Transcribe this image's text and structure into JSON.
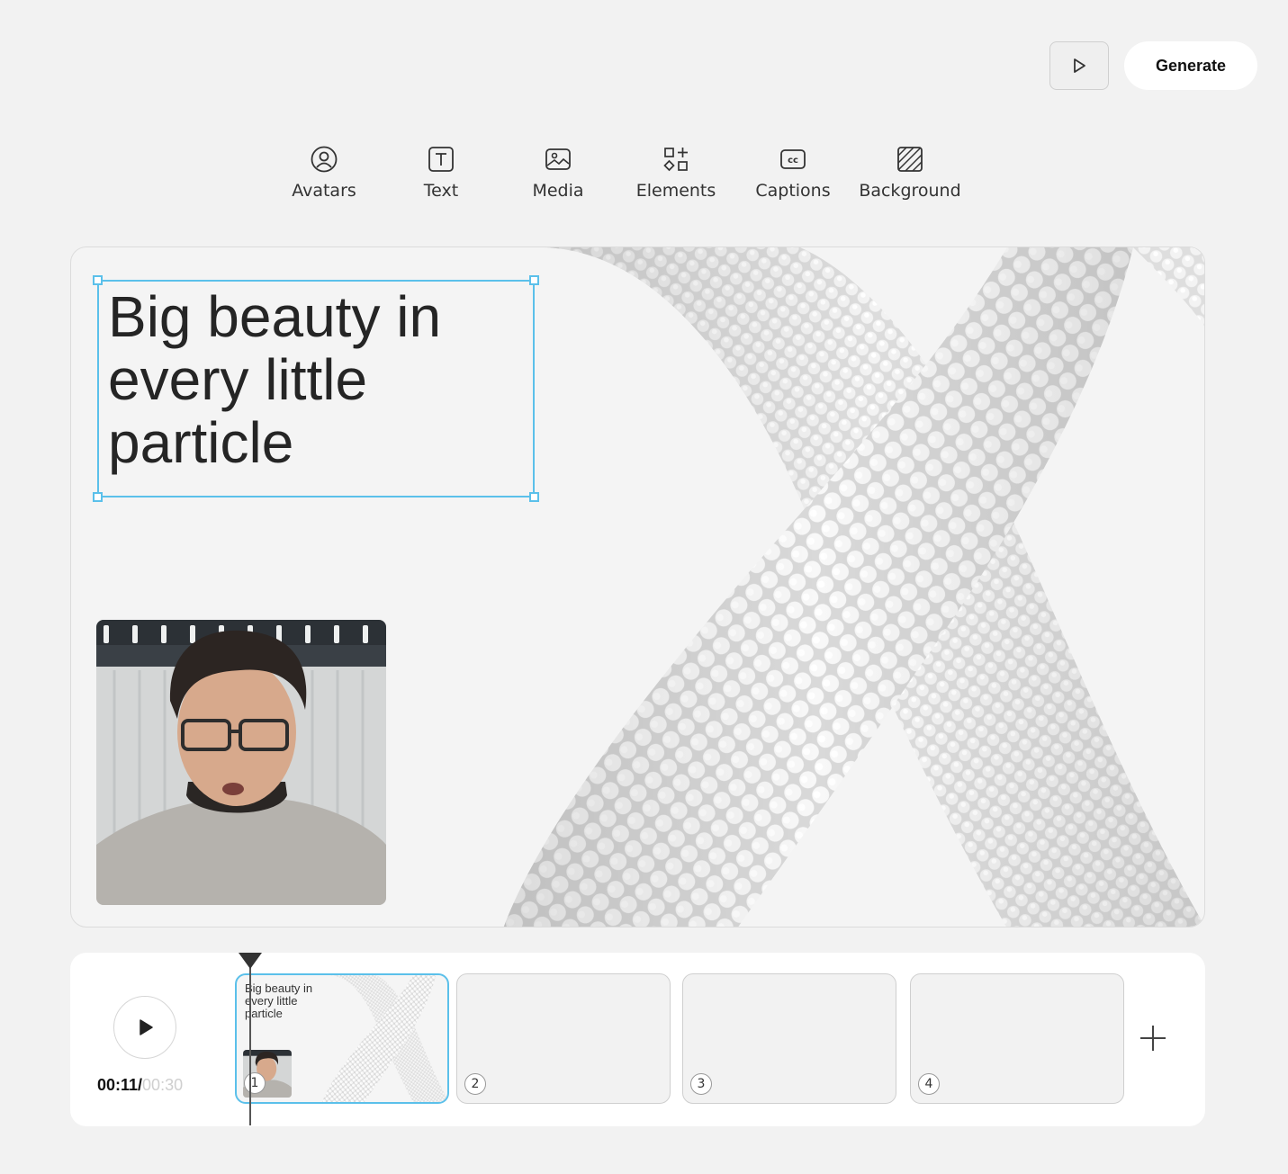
{
  "header": {
    "preview_icon": "play-outline-icon",
    "generate_label": "Generate"
  },
  "toolbar": {
    "items": [
      {
        "label": "Avatars",
        "icon": "avatar-icon"
      },
      {
        "label": "Text",
        "icon": "text-icon"
      },
      {
        "label": "Media",
        "icon": "image-icon"
      },
      {
        "label": "Elements",
        "icon": "shapes-icon"
      },
      {
        "label": "Captions",
        "icon": "captions-icon"
      },
      {
        "label": "Background",
        "icon": "background-pattern-icon"
      }
    ]
  },
  "canvas": {
    "headline": "Big beauty in every little particle",
    "selection_color": "#5bc0ea"
  },
  "timeline": {
    "current_time": "00:11/",
    "total_time": "00:30",
    "scenes": [
      {
        "number": "1",
        "thumb_text": "Big beauty in every little particle"
      },
      {
        "number": "2"
      },
      {
        "number": "3"
      },
      {
        "number": "4"
      }
    ],
    "add_icon": "plus-icon"
  },
  "colors": {
    "accent": "#5bc0ea",
    "background": "#f2f2f2"
  }
}
